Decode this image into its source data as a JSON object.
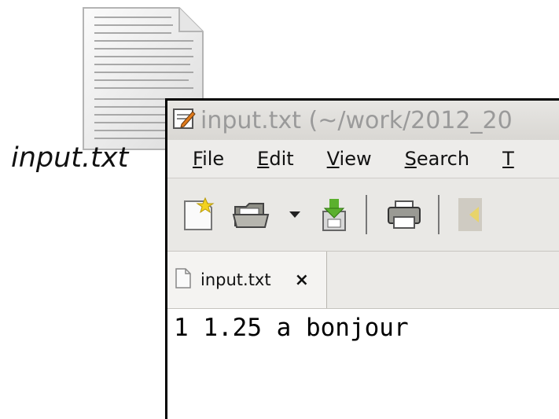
{
  "desktop": {
    "file_label": "input.txt"
  },
  "window": {
    "title": "input.txt (~/work/2012_20",
    "menu": [
      {
        "accel": "F",
        "rest": "ile"
      },
      {
        "accel": "E",
        "rest": "dit"
      },
      {
        "accel": "V",
        "rest": "iew"
      },
      {
        "accel": "S",
        "rest": "earch"
      },
      {
        "accel": "T",
        "rest": ""
      }
    ],
    "toolbar": [
      "new-document-icon",
      "open-folder-icon",
      "dropdown-arrow-icon",
      "save-icon",
      "print-icon"
    ],
    "tab": {
      "label": "input.txt",
      "close": "×"
    },
    "content": "1 1.25 a bonjour"
  }
}
